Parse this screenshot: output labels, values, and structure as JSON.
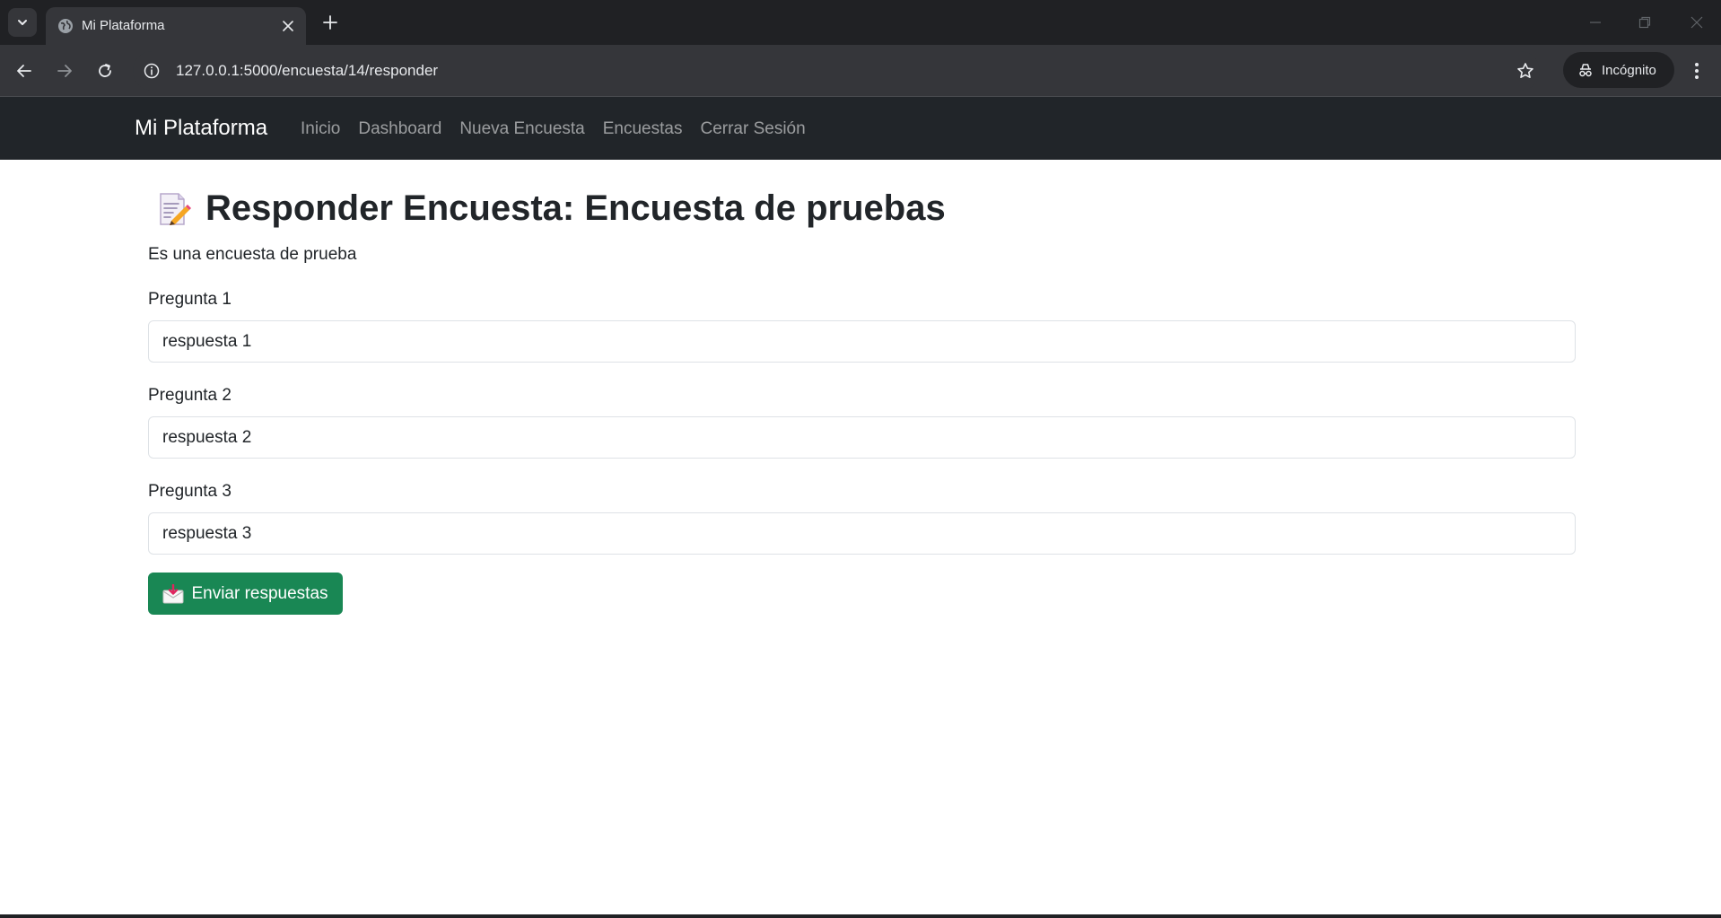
{
  "browser": {
    "tab_title": "Mi Plataforma",
    "url": "127.0.0.1:5000/encuesta/14/responder",
    "incognito_label": "Incógnito"
  },
  "navbar": {
    "brand": "Mi Plataforma",
    "links": [
      "Inicio",
      "Dashboard",
      "Nueva Encuesta",
      "Encuestas",
      "Cerrar Sesión"
    ]
  },
  "page": {
    "title_emoji": "📝",
    "title": "Responder Encuesta: Encuesta de pruebas",
    "description": "Es una encuesta de prueba",
    "questions": [
      {
        "label": "Pregunta 1",
        "value": "respuesta 1"
      },
      {
        "label": "Pregunta 2",
        "value": "respuesta 2"
      },
      {
        "label": "Pregunta 3",
        "value": "respuesta 3"
      }
    ],
    "submit_emoji": "📩",
    "submit_label": "Enviar respuestas"
  },
  "colors": {
    "navbar_bg": "#212529",
    "submit_bg": "#198754",
    "chrome_bg": "#202124",
    "toolbar_bg": "#35363a"
  }
}
